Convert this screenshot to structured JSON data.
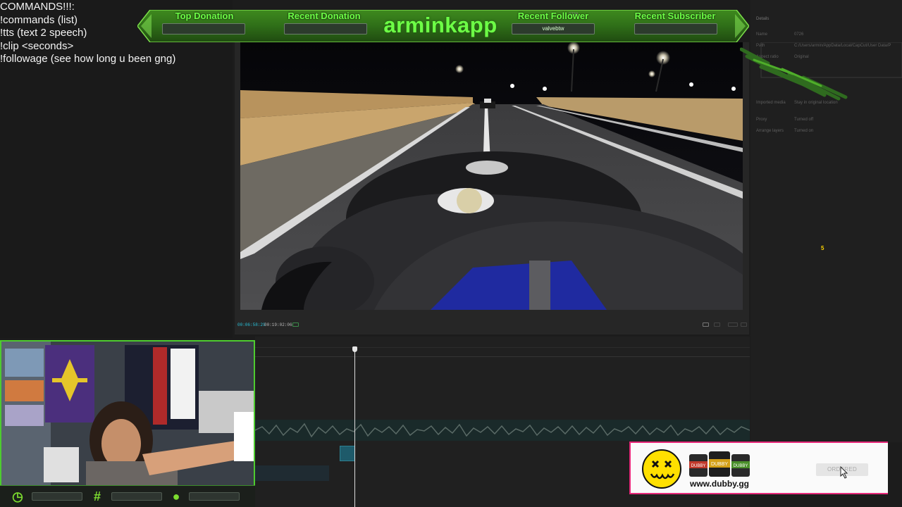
{
  "commands": {
    "lines": [
      "COMMANDS!!!:",
      "!commands (list)",
      "!tts (text 2 speech)",
      "!clip <seconds>",
      "!followage (see how long u been gng)"
    ]
  },
  "banner": {
    "top_donation_label": "Top Donation",
    "top_donation_value": "",
    "recent_donation_label": "Recent Donation",
    "recent_donation_value": "",
    "channel_name": "arminkapp",
    "recent_follower_label": "Recent Follower",
    "recent_follower_value": "valvebtw",
    "recent_subscriber_label": "Recent Subscriber",
    "recent_subscriber_value": "",
    "project_name": "0726"
  },
  "player": {
    "current_time": "00:06:58:29",
    "total_time": "00:19:02:06"
  },
  "details": {
    "title": "Details",
    "rows": [
      {
        "key": "Name",
        "value": "0726"
      },
      {
        "key": "Path",
        "value": "C:/Users/armin/AppData/Local/CapCut/User Data/P"
      },
      {
        "key": "Aspect ratio",
        "value": "Original"
      },
      {
        "key": "Imported media",
        "value": "Stay in original location"
      },
      {
        "key": "Proxy",
        "value": "Turned off"
      },
      {
        "key": "Arrange layers",
        "value": "Turned on"
      }
    ],
    "badge": "5"
  },
  "ad": {
    "url": "www.dubby.gg",
    "button": "ORDERED",
    "tub_labels": [
      "DUBBY",
      "DUBBY",
      "DUBBY"
    ]
  },
  "colors": {
    "accent_green": "#6dff46",
    "cam_border": "#4ecc2f",
    "ad_border": "#e8297a",
    "timecode": "#29c0d8"
  },
  "icons": [
    "clock-icon",
    "hashtag-icon",
    "user-icon",
    "cursor-icon",
    "smiley-icon"
  ]
}
